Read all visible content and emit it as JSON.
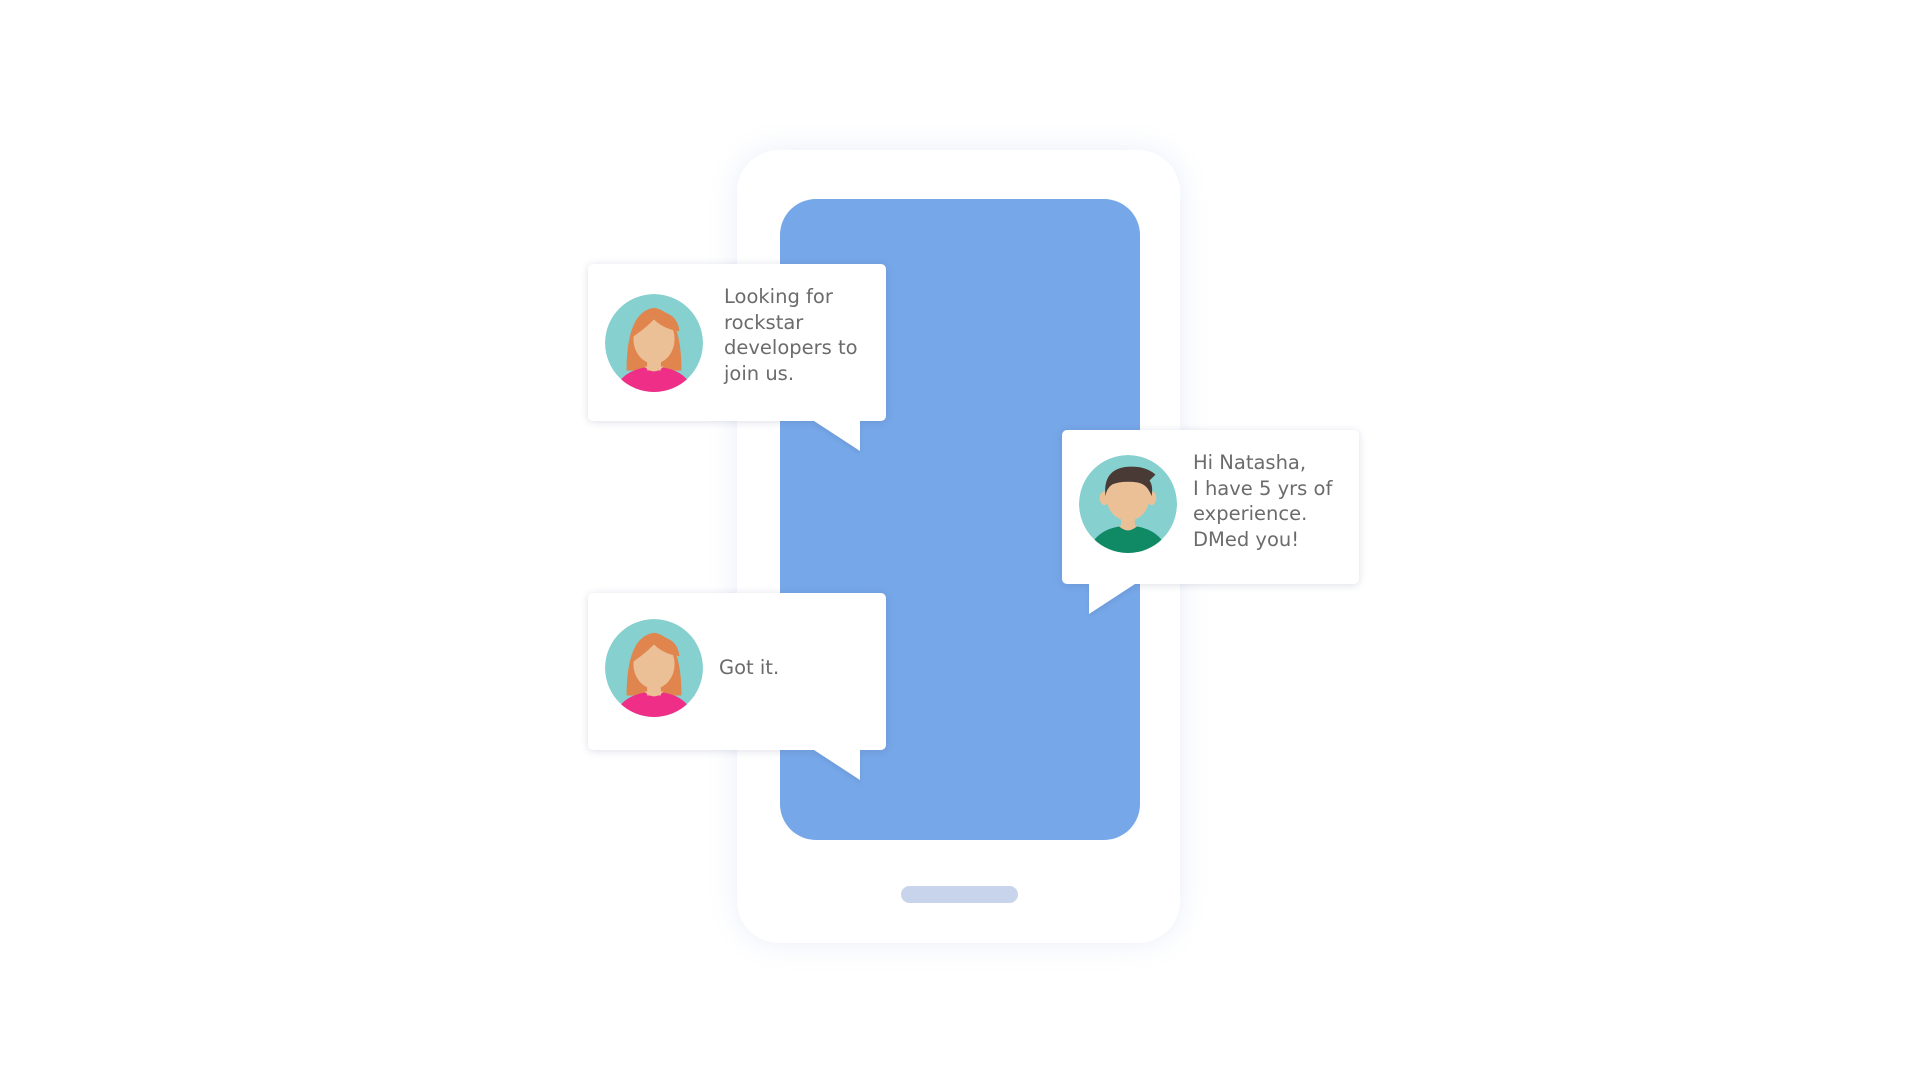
{
  "colors": {
    "phone_body": "#ffffff",
    "phone_screen": "#76a7e8",
    "home_indicator": "#c8d4ec",
    "bubble_background": "#ffffff",
    "message_text": "#6b6b6b",
    "avatar_background": "#86d0cf",
    "female_hair": "#e0854e",
    "female_shirt": "#ef2e88",
    "male_hair": "#4a3a35",
    "male_shirt": "#0f8a65",
    "skin": "#ecc096"
  },
  "messages": [
    {
      "sender_avatar": "female-avatar-icon",
      "text": "Looking for\nrockstar\ndevelopers to\njoin us."
    },
    {
      "sender_avatar": "male-avatar-icon",
      "text": "Hi Natasha,\nI have 5 yrs of\nexperience.\nDMed you!"
    },
    {
      "sender_avatar": "female-avatar-icon",
      "text": "Got it."
    }
  ]
}
